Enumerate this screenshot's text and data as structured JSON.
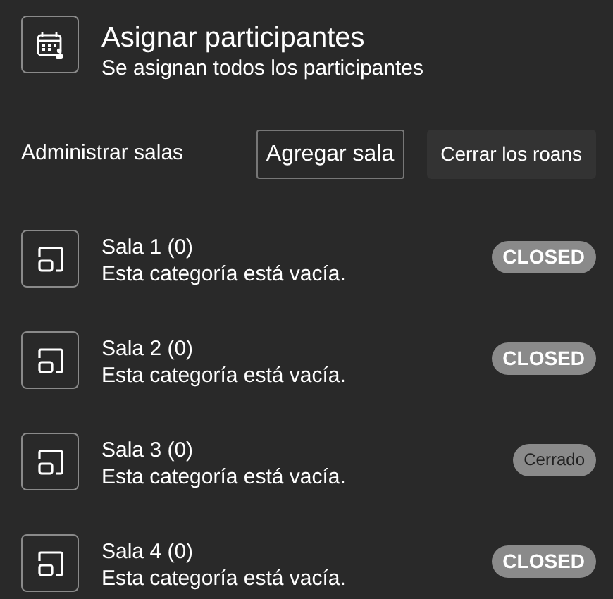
{
  "header": {
    "title": "Asignar participantes",
    "subtitle": "Se asignan todos los participantes"
  },
  "toolbar": {
    "label": "Administrar salas",
    "buttons": [
      {
        "label": "Agregar sala",
        "kind": "outline"
      },
      {
        "label": "Cerrar los roans",
        "kind": "filled"
      }
    ]
  },
  "rooms": [
    {
      "name": "Sala 1 (0)",
      "description": "Esta categoría está vacía.",
      "status": {
        "label": "CLOSED",
        "kind": "caps"
      }
    },
    {
      "name": "Sala 2 (0)",
      "description": "Esta categoría está vacía.",
      "status": {
        "label": "CLOSED",
        "kind": "caps"
      }
    },
    {
      "name": "Sala 3 (0)",
      "description": "Esta categoría está vacía.",
      "status": {
        "label": "Cerrado",
        "kind": "plain"
      }
    },
    {
      "name": "Sala 4 (0)",
      "description": "Esta categoría está vacía.",
      "status": {
        "label": "CLOSED",
        "kind": "caps"
      }
    }
  ]
}
